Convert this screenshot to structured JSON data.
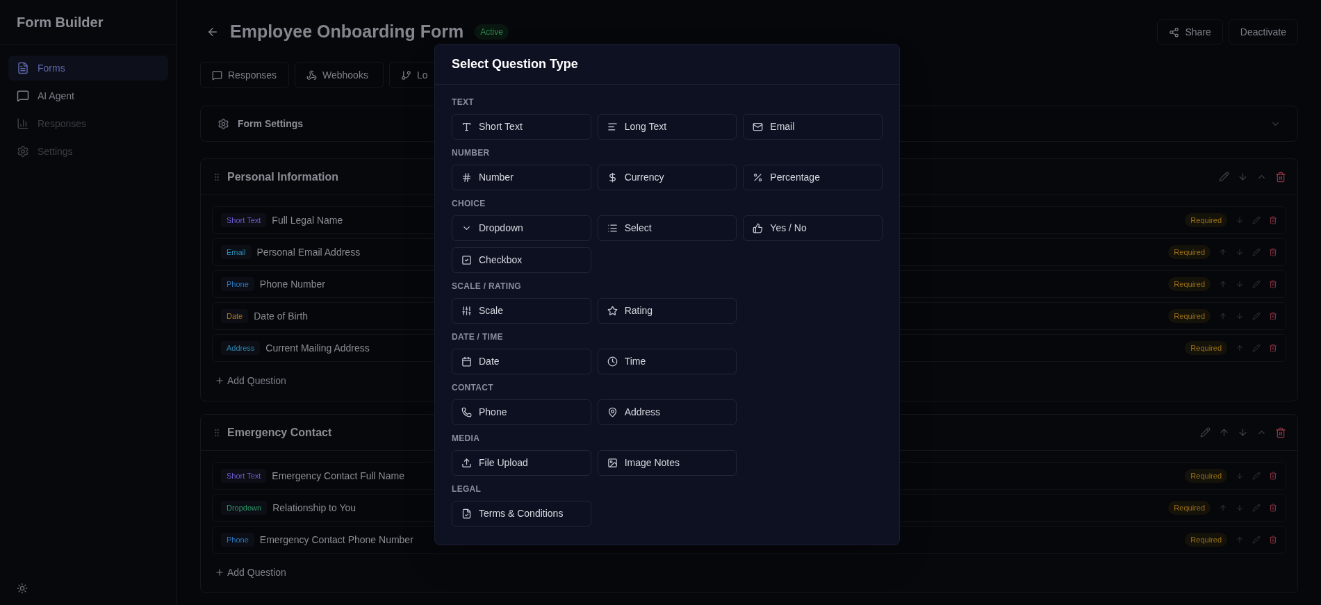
{
  "sidebar": {
    "title": "Form Builder",
    "items": [
      {
        "label": "Forms",
        "kind": "file",
        "selected": true,
        "disabled": false
      },
      {
        "label": "AI Agent",
        "kind": "chat",
        "selected": false,
        "disabled": false
      },
      {
        "label": "Responses",
        "kind": "chart",
        "selected": false,
        "disabled": true
      },
      {
        "label": "Settings",
        "kind": "gear",
        "selected": false,
        "disabled": true
      }
    ]
  },
  "header": {
    "title": "Employee Onboarding Form",
    "status": "Active",
    "buttons": [
      {
        "label": "Share",
        "kind": "share"
      },
      {
        "label": "Deactivate",
        "kind": "plain"
      }
    ]
  },
  "toolbar": [
    {
      "label": "Responses",
      "kind": "chat"
    },
    {
      "label": "Webhooks",
      "kind": "webhook"
    },
    {
      "label": "Lo",
      "kind": "branch"
    }
  ],
  "settings_panel": {
    "title": "Form Settings",
    "expanded": false
  },
  "sections": [
    {
      "title": "Personal Information",
      "move_up": false,
      "move_down": true,
      "add_label": "Add Question",
      "questions": [
        {
          "type": "Short Text",
          "color": "#6d5bd0",
          "label": "Full Legal Name",
          "badge": "Required",
          "move_up": false,
          "move_down": true
        },
        {
          "type": "Email",
          "color": "#2b8fb8",
          "label": "Personal Email Address",
          "badge": "Required",
          "move_up": true,
          "move_down": true
        },
        {
          "type": "Phone",
          "color": "#2a78c0",
          "label": "Phone Number",
          "badge": "Required",
          "move_up": true,
          "move_down": true
        },
        {
          "type": "Date",
          "color": "#b27a1c",
          "label": "Date of Birth",
          "badge": "Required",
          "move_up": true,
          "move_down": true
        },
        {
          "type": "Address",
          "color": "#2b86b0",
          "label": "Current Mailing Address",
          "badge": "Required",
          "move_up": true,
          "move_down": false
        }
      ]
    },
    {
      "title": "Emergency Contact",
      "move_up": true,
      "move_down": true,
      "add_label": "Add Question",
      "questions": [
        {
          "type": "Short Text",
          "color": "#6d5bd0",
          "label": "Emergency Contact Full Name",
          "badge": "Required",
          "move_up": false,
          "move_down": true
        },
        {
          "type": "Dropdown",
          "color": "#2f9a6a",
          "label": "Relationship to You",
          "badge": "Required",
          "move_up": true,
          "move_down": true
        },
        {
          "type": "Phone",
          "color": "#2a78c0",
          "label": "Emergency Contact Phone Number",
          "badge": "Required",
          "move_up": true,
          "move_down": false
        }
      ]
    }
  ],
  "dialog": {
    "title": "Select Question Type",
    "groups": [
      {
        "label": "TEXT",
        "options": [
          {
            "label": "Short Text",
            "kind": "type"
          },
          {
            "label": "Long Text",
            "kind": "lines"
          },
          {
            "label": "Email",
            "kind": "mail"
          }
        ]
      },
      {
        "label": "NUMBER",
        "options": [
          {
            "label": "Number",
            "kind": "hash"
          },
          {
            "label": "Currency",
            "kind": "dollar"
          },
          {
            "label": "Percentage",
            "kind": "percent"
          }
        ]
      },
      {
        "label": "CHOICE",
        "options": [
          {
            "label": "Dropdown",
            "kind": "chevron"
          },
          {
            "label": "Select",
            "kind": "list"
          },
          {
            "label": "Yes / No",
            "kind": "thumb"
          },
          {
            "label": "Checkbox",
            "kind": "check"
          }
        ]
      },
      {
        "label": "SCALE / RATING",
        "options": [
          {
            "label": "Scale",
            "kind": "sliders"
          },
          {
            "label": "Rating",
            "kind": "star"
          }
        ]
      },
      {
        "label": "DATE / TIME",
        "options": [
          {
            "label": "Date",
            "kind": "calendar"
          },
          {
            "label": "Time",
            "kind": "clock"
          }
        ]
      },
      {
        "label": "CONTACT",
        "options": [
          {
            "label": "Phone",
            "kind": "phone"
          },
          {
            "label": "Address",
            "kind": "pin"
          }
        ]
      },
      {
        "label": "MEDIA",
        "options": [
          {
            "label": "File Upload",
            "kind": "upload"
          },
          {
            "label": "Image Notes",
            "kind": "image"
          }
        ]
      },
      {
        "label": "LEGAL",
        "options": [
          {
            "label": "Terms & Conditions",
            "kind": "filecheck"
          }
        ]
      }
    ]
  }
}
